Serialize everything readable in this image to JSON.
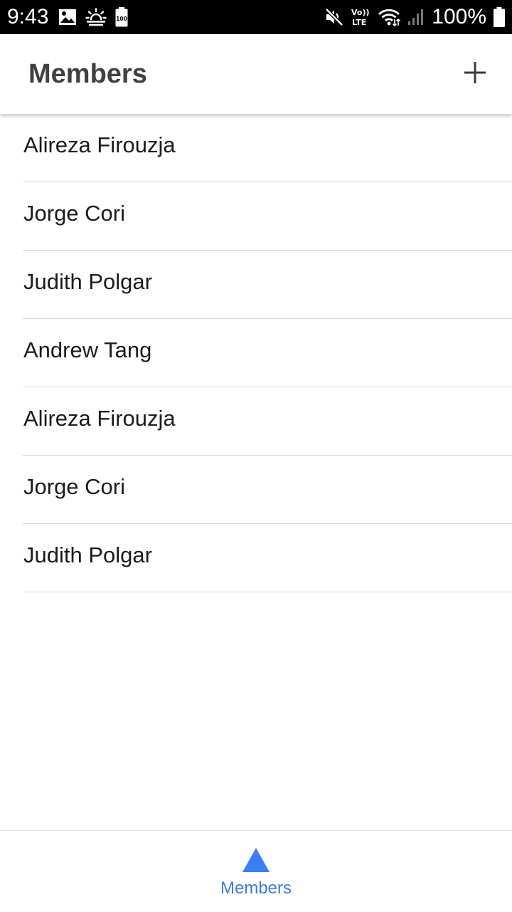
{
  "status_bar": {
    "time": "9:43",
    "battery_percent": "100%",
    "left_icons": [
      "image-icon",
      "weather-icon",
      "battery-saver-icon"
    ],
    "right_icons": [
      "mute-icon",
      "volte-icon",
      "wifi-icon",
      "signal-icon",
      "battery-icon"
    ],
    "volte_top": "Vo))",
    "volte_bottom": "LTE",
    "battery_saver_label": "100"
  },
  "app_bar": {
    "title": "Members",
    "add_icon": "plus-icon"
  },
  "members": [
    {
      "name": "Alireza Firouzja"
    },
    {
      "name": "Jorge Cori"
    },
    {
      "name": "Judith Polgar"
    },
    {
      "name": "Andrew Tang"
    },
    {
      "name": "Alireza Firouzja"
    },
    {
      "name": "Jorge Cori"
    },
    {
      "name": "Judith Polgar"
    }
  ],
  "bottom_nav": {
    "items": [
      {
        "label": "Members",
        "icon": "triangle-icon",
        "selected": true
      }
    ]
  },
  "colors": {
    "accent": "#3d7be0",
    "nav_icon": "#3a7ff5",
    "title_text": "#404040",
    "list_text": "#1b1b1b",
    "divider": "#d6d6d6",
    "status_bar_bg": "#000000"
  }
}
